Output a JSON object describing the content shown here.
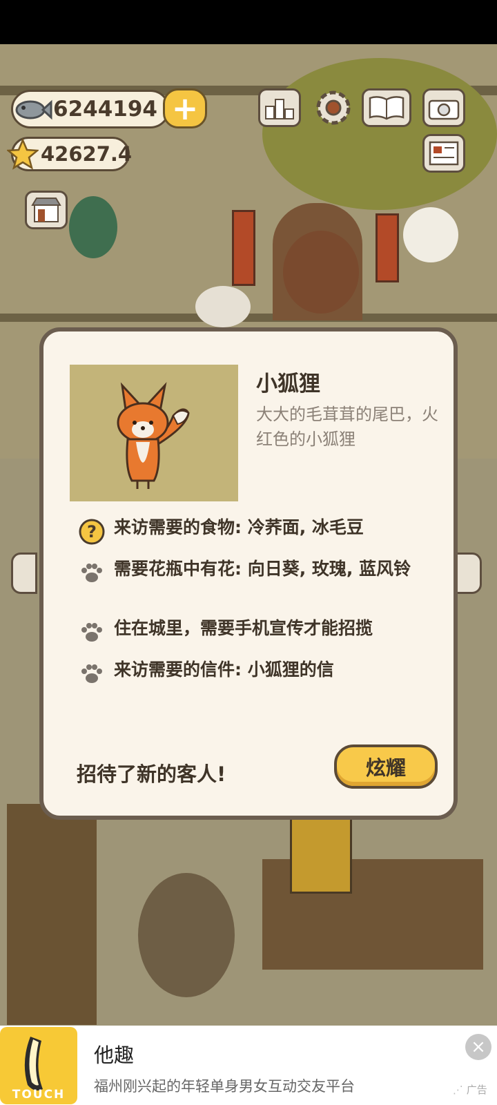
{
  "hud": {
    "fish_count": "6244194",
    "star_count": "42627.4",
    "plus_label": "+",
    "icons": [
      "ranking-icon",
      "gear-icon",
      "album-icon",
      "camera-icon",
      "newspaper-icon",
      "shop-icon"
    ]
  },
  "dialog": {
    "name": "小狐狸",
    "description": "大大的毛茸茸的尾巴，火红色的小狐狸",
    "requirements": [
      {
        "icon": "question-icon",
        "text": "来访需要的食物: 冷荞面, 冰毛豆"
      },
      {
        "icon": "paw-icon",
        "text": "需要花瓶中有花: 向日葵, 玫瑰, 蓝风铃"
      },
      {
        "icon": "paw-icon",
        "text": "住在城里，需要手机宣传才能招揽"
      },
      {
        "icon": "paw-icon",
        "text": "来访需要的信件: 小狐狸的信"
      }
    ],
    "footer_text": "招待了新的客人!",
    "button_label": "炫耀"
  },
  "ad": {
    "logo_text": "TOUCH",
    "title": "他趣",
    "subtitle": "福州刚兴起的年轻单身男女互动交友平台",
    "close_label": "×",
    "badge": "广告"
  },
  "colors": {
    "accent_yellow": "#f8c94a",
    "dialog_bg": "#faf4ea",
    "dialog_border": "#6b5d4f",
    "portrait_bg": "#c3b479",
    "fox_orange": "#e8792f"
  }
}
